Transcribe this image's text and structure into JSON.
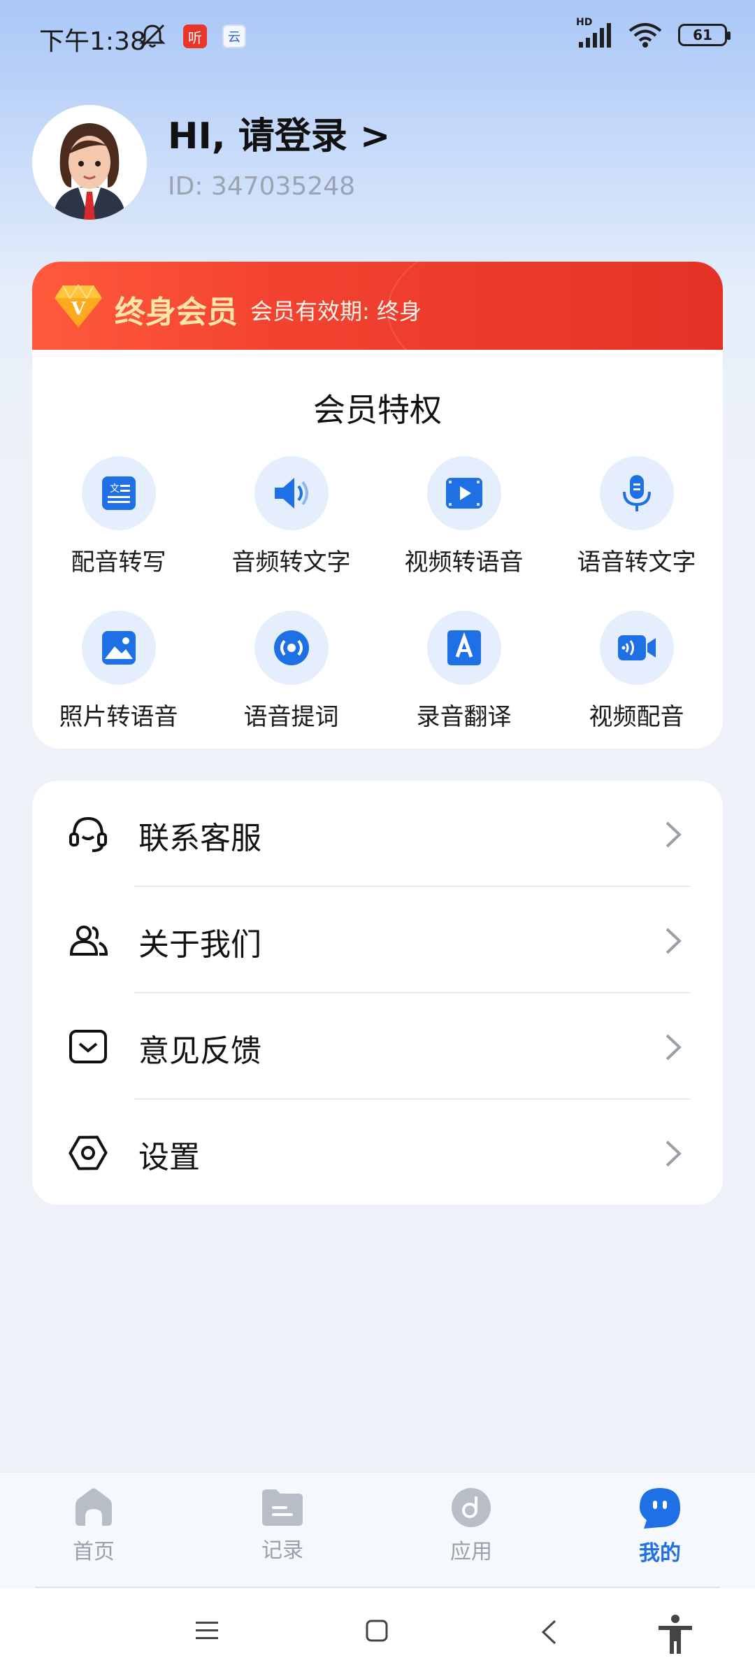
{
  "status_bar": {
    "time": "下午1:38",
    "badge_red": "听",
    "badge_blue": "云",
    "network": "HD",
    "battery": "61"
  },
  "profile": {
    "greeting": "HI, 请登录 >",
    "user_id": "ID: 347035248"
  },
  "membership": {
    "level": "终身会员",
    "validity": "会员有效期: 终身",
    "privileges_title": "会员特权",
    "privileges": [
      {
        "label": "配音转写",
        "icon": "text-convert-icon"
      },
      {
        "label": "音频转文字",
        "icon": "speaker-icon"
      },
      {
        "label": "视频转语音",
        "icon": "video-play-icon"
      },
      {
        "label": "语音转文字",
        "icon": "microphone-icon"
      },
      {
        "label": "照片转语音",
        "icon": "photo-icon"
      },
      {
        "label": "语音提词",
        "icon": "broadcast-icon"
      },
      {
        "label": "录音翻译",
        "icon": "translate-icon"
      },
      {
        "label": "视频配音",
        "icon": "video-camera-icon"
      }
    ],
    "colors": {
      "banner": "#ee3a2b",
      "level_text": "#ffe5a8",
      "icon_bg": "#e4eefc",
      "icon_fg": "#1f6fe5"
    }
  },
  "menu": {
    "items": [
      {
        "label": "联系客服",
        "icon": "headset-icon"
      },
      {
        "label": "关于我们",
        "icon": "users-icon"
      },
      {
        "label": "意见反馈",
        "icon": "feedback-icon"
      },
      {
        "label": "设置",
        "icon": "settings-icon"
      }
    ]
  },
  "bottom_nav": {
    "items": [
      {
        "label": "首页",
        "icon": "home-icon"
      },
      {
        "label": "记录",
        "icon": "folder-icon"
      },
      {
        "label": "应用",
        "icon": "apps-icon"
      },
      {
        "label": "我的",
        "icon": "profile-icon"
      }
    ],
    "active": "我的",
    "active_color": "#1f6fe5"
  }
}
